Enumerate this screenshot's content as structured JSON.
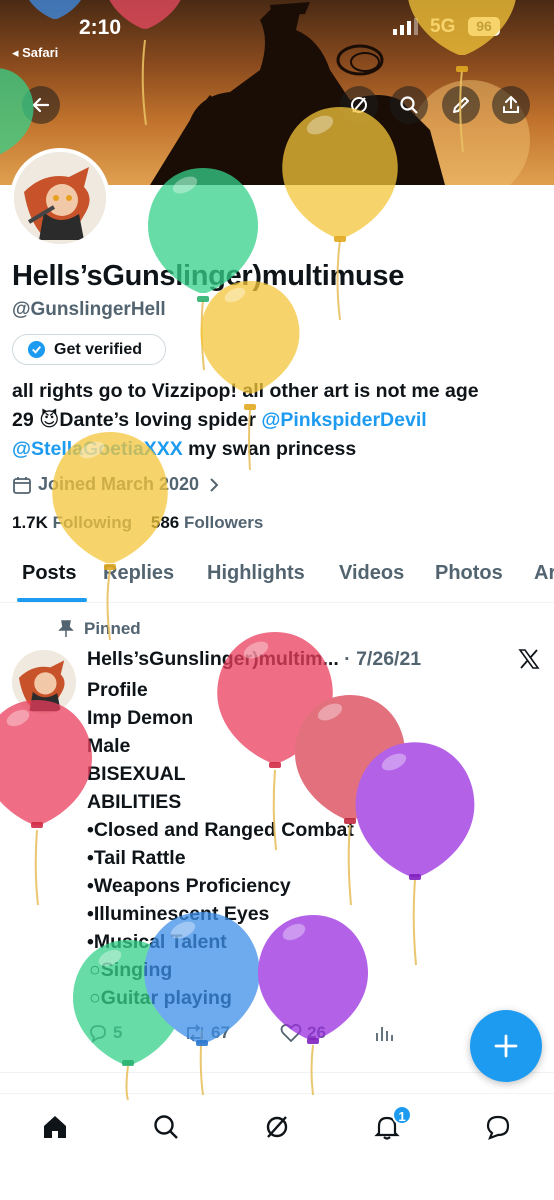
{
  "status_bar": {
    "time": "2:10",
    "back_app": "◂ Safari",
    "network": "5G",
    "battery": "96"
  },
  "header": {
    "back_icon": "arrow-left-icon",
    "actions": [
      "grok-icon",
      "search-icon",
      "edit-icon",
      "share-icon"
    ]
  },
  "profile": {
    "display_name": "Hells’sGunslinger)multimuse",
    "handle": "@GunslingerHell",
    "verify_label": "Get verified",
    "bio": {
      "line1": "all rights go to Vizzipop! all other art is not me age",
      "line2_pre": "29 😈Dante’s loving spider ",
      "mention1": "@PinkspiderDevil",
      "mention2": "@StellaGoetiaXXX",
      "line3_post": " my swan princess"
    },
    "joined": "Joined March 2020",
    "following_count": "1.7K",
    "following_label": "Following",
    "followers_count": "586",
    "followers_label": "Followers"
  },
  "tabs": [
    "Posts",
    "Replies",
    "Highlights",
    "Videos",
    "Photos",
    "Ar"
  ],
  "post": {
    "pinned_label": "Pinned",
    "author": "Hells’sGunslinger)multim...",
    "date": "· 7/26/21",
    "lines": [
      "Profile",
      "Imp Demon",
      "Male",
      "BISEXUAL",
      "ABILITIES",
      "•Closed and Ranged Combat",
      "•Tail Rattle",
      "•Weapons Proficiency",
      "•Illuminescent Eyes",
      "•Musical Talent",
      "○Singing",
      "○Guitar playing"
    ],
    "replies": "5",
    "reposts": "67",
    "likes": "26"
  },
  "bottom_nav": {
    "items": [
      "home-icon",
      "search-icon",
      "grok-icon",
      "notifications-icon",
      "messages-icon"
    ],
    "notification_count": "1"
  },
  "colors": {
    "accent": "#1d9bf0",
    "text": "#0f1419",
    "muted": "#536471"
  }
}
